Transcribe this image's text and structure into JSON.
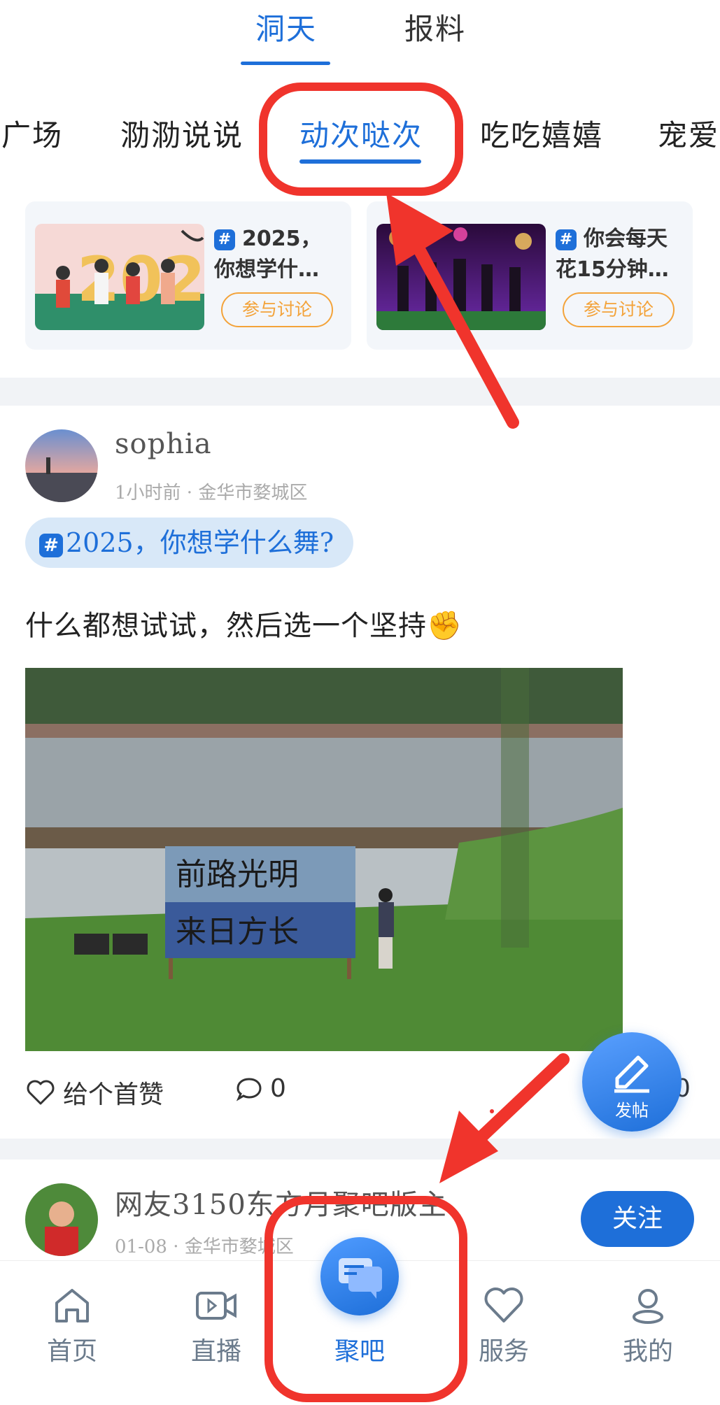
{
  "top_tabs": [
    {
      "label": "洞天",
      "active": true
    },
    {
      "label": "报料",
      "active": false
    }
  ],
  "channels": [
    {
      "label": "广场"
    },
    {
      "label": "泐泐说说"
    },
    {
      "label": "动次哒次",
      "active": true
    },
    {
      "label": "吃吃嬉嬉"
    },
    {
      "label": "宠爱"
    }
  ],
  "topics": [
    {
      "line1": "2025，",
      "line2": "你想学什…",
      "button": "参与讨论"
    },
    {
      "line1": "你会每天",
      "line2": "花15分钟…",
      "button": "参与讨论"
    }
  ],
  "post": {
    "username": "sophia",
    "meta": "1小时前 · 金华市婺城区",
    "hashtag": "2025，你想学什么舞?",
    "text": "什么都想试试，然后选一个坚持✊",
    "image_sign_line1": "前路光明",
    "image_sign_line2": "来日方长",
    "like_label": "给个首赞",
    "comment_count": "0",
    "share_count": "0"
  },
  "post2": {
    "username": "网友3150东方月聚吧版主",
    "meta": "01-08 · 金华市婺城区",
    "follow_label": "关注"
  },
  "fab_label": "发帖",
  "bottom_nav": [
    {
      "label": "首页",
      "icon": "home-icon"
    },
    {
      "label": "直播",
      "icon": "video-icon"
    },
    {
      "label": "聚吧",
      "icon": "chat-bubbles-icon",
      "active": true
    },
    {
      "label": "服务",
      "icon": "heart-icon"
    },
    {
      "label": "我的",
      "icon": "user-icon"
    }
  ],
  "colors": {
    "accent": "#1e6fd9",
    "orange": "#f3a33a",
    "annotation_red": "#f0342c"
  }
}
